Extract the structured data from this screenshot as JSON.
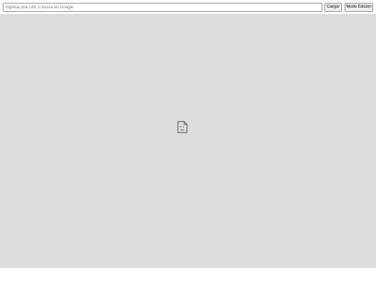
{
  "toolbar": {
    "url_placeholder": "Ingresa una URL o busca en Google",
    "url_value": "",
    "load_label": "Cargar",
    "edit_mode_label": "Modo Edición"
  },
  "frame": {
    "state": "error",
    "icon": "sad-document-icon"
  },
  "colors": {
    "frame_background": "#dcdcdc",
    "button_background": "#efefef",
    "border": "#8f8f8f"
  }
}
